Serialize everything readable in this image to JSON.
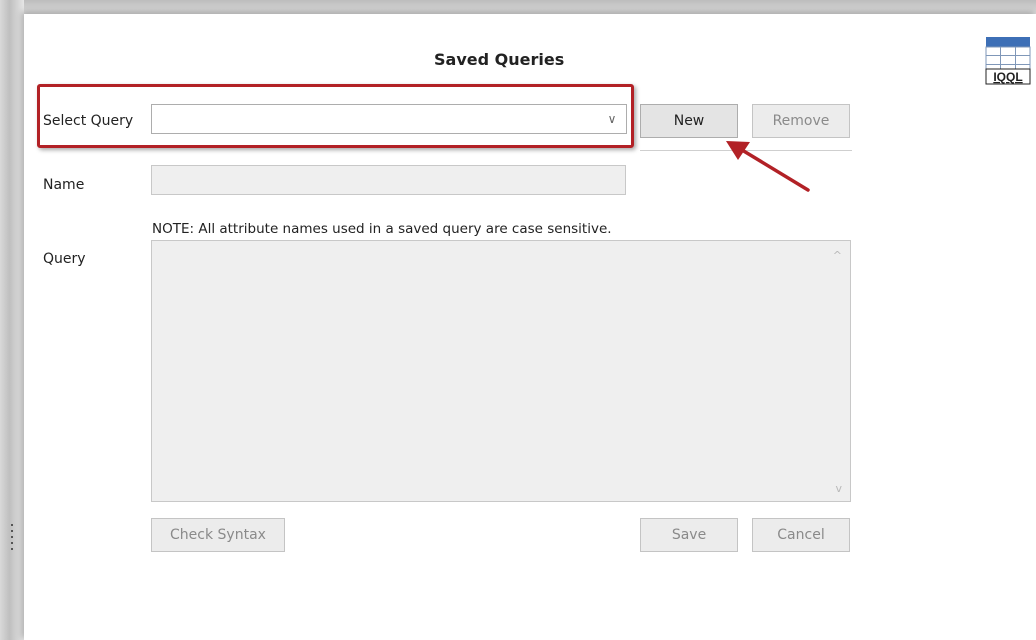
{
  "dialog": {
    "title": "Saved Queries",
    "logo_text": "IQQL"
  },
  "select_query": {
    "label": "Select Query",
    "value": "",
    "dropdown_glyph": "∨"
  },
  "buttons": {
    "new": "New",
    "remove": "Remove",
    "check_syntax": "Check Syntax",
    "save": "Save",
    "cancel": "Cancel"
  },
  "name": {
    "label": "Name",
    "value": ""
  },
  "note": "NOTE:  All attribute names used in a saved query are case sensitive.",
  "query": {
    "label": "Query",
    "value": "",
    "scroll_up": "^",
    "scroll_down": "v"
  },
  "annotation": {
    "highlight_color": "#b22126",
    "arrow_color": "#b22126"
  }
}
